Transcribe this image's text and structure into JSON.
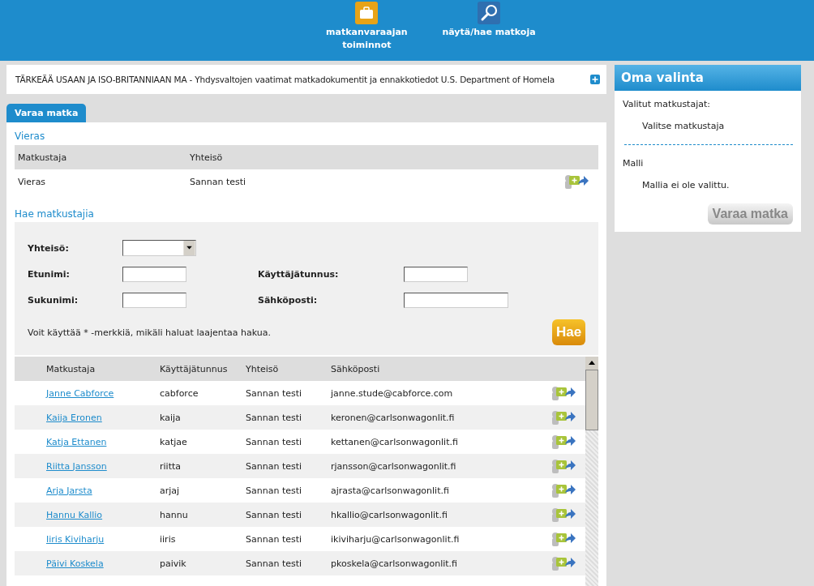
{
  "top_nav": [
    {
      "kind": "briefcase",
      "label": "matkanvaraajan toiminnot"
    },
    {
      "kind": "search",
      "label": "näytä/hae matkoja"
    }
  ],
  "notice": {
    "text": "TÄRKEÄÄ USAAN JA ISO-BRITANNIAAN MA - Yhdysvaltojen vaatimat matkadokumentit ja ennakkotiedot U.S. Department of Homela"
  },
  "tabs": [
    {
      "label": "Varaa matka",
      "selected": true
    }
  ],
  "guest": {
    "heading": "Vieras",
    "columns": [
      "Matkustaja",
      "Yhteisö"
    ],
    "rows": [
      {
        "traveler": "Vieras",
        "organization": "Sannan testi"
      }
    ]
  },
  "search": {
    "heading": "Hae matkustajia",
    "organization_label": "Yhteisö:",
    "first_name_label": "Etunimi:",
    "username_label": "Käyttäjätunnus:",
    "last_name_label": "Sukunimi:",
    "email_label": "Sähköposti:",
    "hint": "Voit käyttää * -merkkiä, mikäli haluat laajentaa hakua.",
    "button": "Hae"
  },
  "results": {
    "columns": [
      "Matkustaja",
      "Käyttäjätunnus",
      "Yhteisö",
      "Sähköposti"
    ],
    "rows": [
      {
        "name": "Janne Cabforce",
        "username": "cabforce",
        "organization": "Sannan testi",
        "email": "janne.stude@cabforce.com"
      },
      {
        "name": "Kaija Eronen",
        "username": "kaija",
        "organization": "Sannan testi",
        "email": "keronen@carlsonwagonlit.fi"
      },
      {
        "name": "Katja Ettanen",
        "username": "katjae",
        "organization": "Sannan testi",
        "email": "kettanen@carlsonwagonlit.fi"
      },
      {
        "name": "Riitta Jansson",
        "username": "riitta",
        "organization": "Sannan testi",
        "email": "rjansson@carlsonwagonlit.fi"
      },
      {
        "name": "Arja Jarsta",
        "username": "arjaj",
        "organization": "Sannan testi",
        "email": "ajrasta@carlsonwagonlit.fi"
      },
      {
        "name": "Hannu Kallio",
        "username": "hannu",
        "organization": "Sannan testi",
        "email": "hkallio@carlsonwagonlit.fi"
      },
      {
        "name": "Iiris Kiviharju",
        "username": "iiris",
        "organization": "Sannan testi",
        "email": "ikiviharju@carlsonwagonlit.fi"
      },
      {
        "name": "Päivi Koskela",
        "username": "paivik",
        "organization": "Sannan testi",
        "email": "pkoskela@carlsonwagonlit.fi"
      }
    ]
  },
  "own_selection": {
    "title": "Oma valinta",
    "selected_label": "Valitut matkustajat:",
    "selected_placeholder": "Valitse matkustaja",
    "template_label": "Malli",
    "template_placeholder": "Mallia ei ole valittu.",
    "button": "Varaa matka",
    "button_disabled": true
  }
}
